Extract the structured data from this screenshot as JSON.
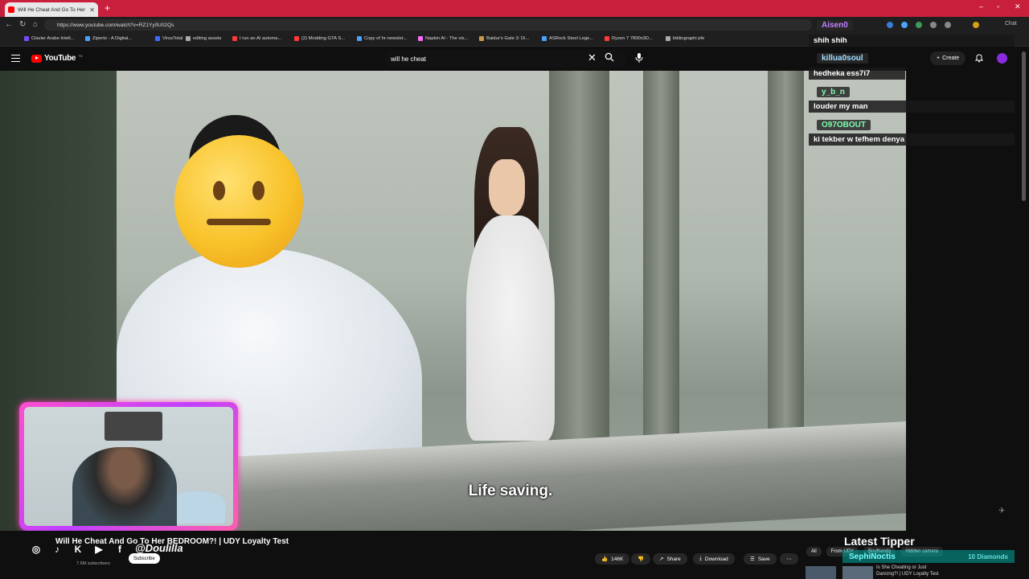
{
  "browser": {
    "tab_title": "Will He Cheat And Go To Her BEDROOM",
    "url": "https://www.youtube.com/watch?v=RZ1Yy0U02Qs",
    "chat_label": "Chat",
    "bookmarks": [
      {
        "label": "Clavier Arabe Intell...",
        "color": "#7a4aff"
      },
      {
        "label": "Ziperto - A Digital...",
        "color": "#4aa3ff"
      },
      {
        "label": "VirusTotal",
        "color": "#3a6cff"
      },
      {
        "label": "editing assets",
        "color": "#aaaaaa"
      },
      {
        "label": "I run an AI automa...",
        "color": "#ff3a3a"
      },
      {
        "label": "(2) Modding GTA S...",
        "color": "#ff3a3a"
      },
      {
        "label": "Copy of hr-newslet...",
        "color": "#4aa3ff"
      },
      {
        "label": "Napkin AI - The vis...",
        "color": "#ff6aff"
      },
      {
        "label": "Baldur's Gate 3: Di...",
        "color": "#c89a4a"
      },
      {
        "label": "ASRock Steel Lege...",
        "color": "#4aa3ff"
      },
      {
        "label": "Ryzen 7 7800x3D...",
        "color": "#ff3a3a"
      },
      {
        "label": "bibliographi pfe",
        "color": "#aaaaaa"
      }
    ]
  },
  "youtube": {
    "logo_text": "YouTube",
    "logo_cc": "TN",
    "search_value": "will he cheat",
    "create_label": "Create"
  },
  "video": {
    "subtitle": "Life saving.",
    "title": "Will He Cheat And Go To Her BEDROOM?! | UDY Loyalty Test",
    "subscribers": "7.6M subscribers",
    "subscribe_label": "Subscribe",
    "likes": "146K",
    "share_label": "Share",
    "download_label": "Download",
    "save_label": "Save"
  },
  "overlay": {
    "handle": "@Doulilla",
    "latest_tipper_label": "Latest Tipper",
    "tipper_name": "SephiNoctis",
    "tipper_amount": "10 Diamonds"
  },
  "chat": [
    {
      "user": "Aisen0",
      "user_color": "#c080ff",
      "message": "shih shih"
    },
    {
      "user": "killua0soul",
      "user_color": "#a0e0ff",
      "message": "hedheka ess7i7"
    },
    {
      "user": "y_b_n",
      "user_color": "#7fffb0",
      "message": "louder my man"
    },
    {
      "user": "O97OBOUT",
      "user_color": "#7fffb0",
      "message": "ki tekber w tefhem denya"
    }
  ],
  "filters": [
    "All",
    "From UDY",
    "Boyfriends",
    "Hidden camera"
  ],
  "recommended": {
    "line1": "Is She Cheating or Just",
    "line2": "Dancing?! | UDY Loyalty Test"
  }
}
